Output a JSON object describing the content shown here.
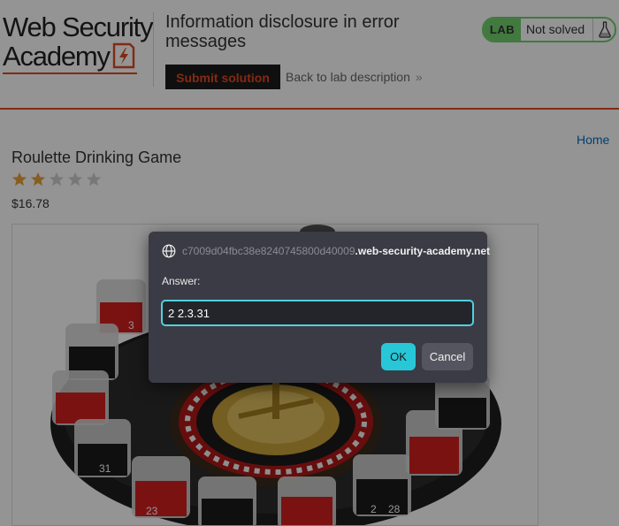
{
  "header": {
    "logo_line1": "Web Security",
    "logo_line2": "Academy",
    "lab_title": "Information disclosure in error messages",
    "submit_label": "Submit solution",
    "back_label": "Back to lab description",
    "status_badge": "LAB",
    "status_text": "Not solved",
    "status_icon": "flask-icon"
  },
  "nav": {
    "home_label": "Home"
  },
  "product": {
    "title": "Roulette Drinking Game",
    "rating": 2,
    "rating_max": 5,
    "price": "$16.78",
    "shot_glass_numbers": [
      "3",
      "31",
      "23",
      "2",
      "28"
    ]
  },
  "dialog": {
    "origin_faded": "c7009d04fbc38e8240745800d40009",
    "origin_rest": ".web-security-academy.net",
    "label": "Answer:",
    "input_value": "2 2.3.31",
    "ok_label": "OK",
    "cancel_label": "Cancel",
    "icon": "globe-icon"
  },
  "colors": {
    "brand_orange": "#e24920",
    "status_green": "#70d16d",
    "dialog_bg": "#3b3b45",
    "ok_cyan": "#27c7d8",
    "link_blue": "#0071bc",
    "star_gold": "#e8a33a",
    "star_grey": "#cfcfcf"
  }
}
